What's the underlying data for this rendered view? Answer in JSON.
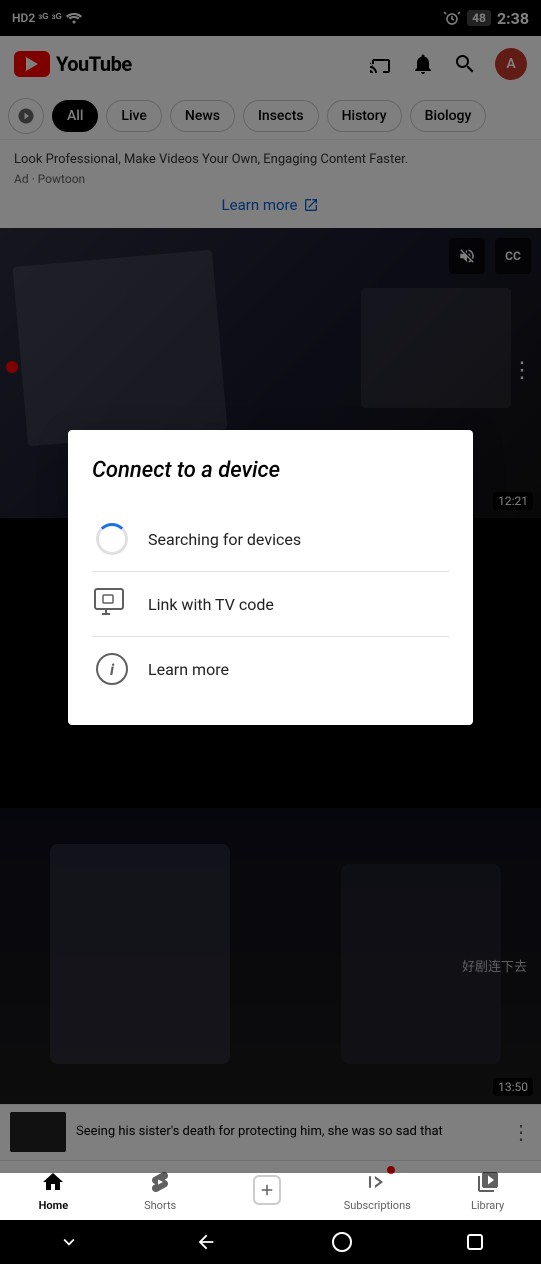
{
  "statusBar": {
    "left": "HD2  4G  4G",
    "time": "2:38",
    "battery": "48"
  },
  "header": {
    "logoText": "YouTube",
    "icons": [
      "cast",
      "notifications",
      "search",
      "account"
    ]
  },
  "filterChips": [
    {
      "id": "explore",
      "label": "",
      "active": false,
      "type": "icon"
    },
    {
      "id": "all",
      "label": "All",
      "active": true
    },
    {
      "id": "live",
      "label": "Live",
      "active": false
    },
    {
      "id": "news",
      "label": "News",
      "active": false
    },
    {
      "id": "insects",
      "label": "Insects",
      "active": false
    },
    {
      "id": "history",
      "label": "History",
      "active": false
    },
    {
      "id": "biology",
      "label": "Biology",
      "active": false
    }
  ],
  "ad": {
    "text": "Look Professional, Make Videos Your Own, Engaging Content Faster.",
    "source": "Ad · Powtoon",
    "learnMore": "Learn more"
  },
  "video1": {
    "duration": "12:21"
  },
  "dialog": {
    "title": "Connect to a device",
    "items": [
      {
        "id": "search",
        "icon": "spinner",
        "text": "Searching for devices"
      },
      {
        "id": "tv-code",
        "icon": "tv",
        "text": "Link with TV code"
      },
      {
        "id": "learn-more",
        "icon": "info",
        "text": "Learn more"
      }
    ]
  },
  "video2": {
    "watermark": "好剧连下去",
    "duration": "13:50"
  },
  "miniPlayer": {
    "title": "Seeing his sister's death for protecting him, she was so sad that"
  },
  "bottomNav": {
    "items": [
      {
        "id": "home",
        "label": "Home",
        "active": true
      },
      {
        "id": "shorts",
        "label": "Shorts",
        "active": false
      },
      {
        "id": "create",
        "label": "",
        "active": false
      },
      {
        "id": "subscriptions",
        "label": "Subscriptions",
        "active": false,
        "badge": true
      },
      {
        "id": "library",
        "label": "Library",
        "active": false
      }
    ]
  },
  "systemNav": {
    "buttons": [
      "chevron-down",
      "back",
      "home",
      "square"
    ]
  }
}
